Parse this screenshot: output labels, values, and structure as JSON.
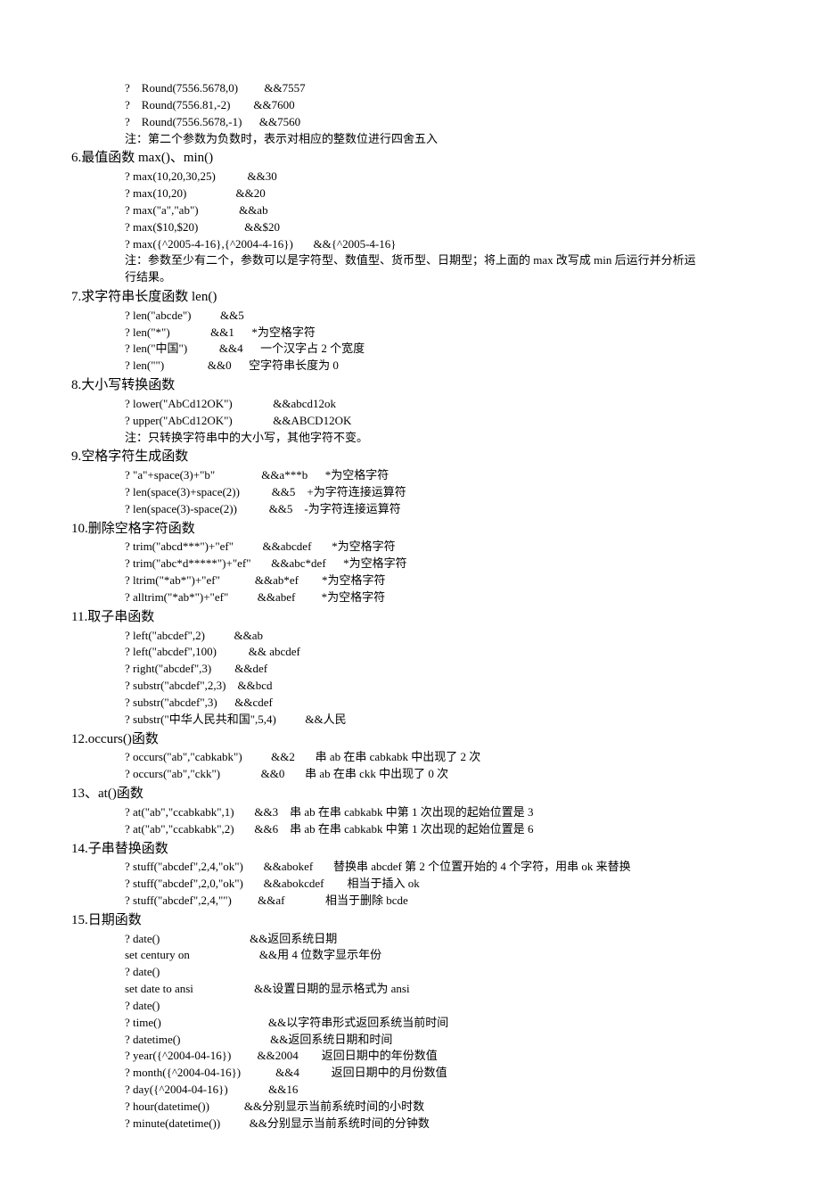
{
  "lines": [
    {
      "cls": "indent1",
      "t": "?    Round(7556.5678,0)         &&7557"
    },
    {
      "cls": "indent1",
      "t": "?    Round(7556.81,-2)        &&7600"
    },
    {
      "cls": "indent1",
      "t": "?    Round(7556.5678,-1)      &&7560"
    },
    {
      "cls": "indent1",
      "t": "注：第二个参数为负数时，表示对相应的整数位进行四舍五入"
    },
    {
      "cls": "heading",
      "t": "6.最值函数 max()、min()"
    },
    {
      "cls": "indent2",
      "t": "? max(10,20,30,25)           &&30"
    },
    {
      "cls": "indent2",
      "t": "? max(10,20)                 &&20"
    },
    {
      "cls": "indent2",
      "t": "? max(\"a\",\"ab\")              &&ab"
    },
    {
      "cls": "indent2",
      "t": "? max($10,$20)                &&$20"
    },
    {
      "cls": "indent2",
      "t": "? max({^2005-4-16},{^2004-4-16})       &&{^2005-4-16}"
    },
    {
      "cls": "indent2",
      "t": "注：参数至少有二个，参数可以是字符型、数值型、货币型、日期型；将上面的 max 改写成 min 后运行并分析运"
    },
    {
      "cls": "indent2",
      "t": "行结果。"
    },
    {
      "cls": "heading",
      "t": "7.求字符串长度函数 len()"
    },
    {
      "cls": "indent2",
      "t": "? len(\"abcde\")          &&5"
    },
    {
      "cls": "indent2",
      "t": "? len(\"*\")              &&1      *为空格字符"
    },
    {
      "cls": "indent2",
      "t": "? len(\"中国\")           &&4      一个汉字占 2 个宽度"
    },
    {
      "cls": "indent2",
      "t": "? len(\"\")               &&0      空字符串长度为 0"
    },
    {
      "cls": "heading",
      "t": "8.大小写转换函数"
    },
    {
      "cls": "indent2",
      "t": "? lower(\"AbCd12OK\")              &&abcd12ok"
    },
    {
      "cls": "indent2",
      "t": "? upper(\"AbCd12OK\")              &&ABCD12OK"
    },
    {
      "cls": "indent2",
      "t": "注：只转换字符串中的大小写，其他字符不变。"
    },
    {
      "cls": "heading",
      "t": "9.空格字符生成函数"
    },
    {
      "cls": "indent2",
      "t": "? \"a\"+space(3)+\"b\"                &&a***b      *为空格字符"
    },
    {
      "cls": "indent2",
      "t": "? len(space(3)+space(2))           &&5    +为字符连接运算符"
    },
    {
      "cls": "indent2",
      "t": "? len(space(3)-space(2))           &&5    -为字符连接运算符"
    },
    {
      "cls": "heading",
      "t": "10.删除空格字符函数"
    },
    {
      "cls": "indent2",
      "t": "? trim(\"abcd***\")+\"ef\"          &&abcdef       *为空格字符"
    },
    {
      "cls": "indent2",
      "t": "? trim(\"abc*d*****\")+\"ef\"       &&abc*def      *为空格字符"
    },
    {
      "cls": "indent2",
      "t": "? ltrim(\"*ab*\")+\"ef\"            &&ab*ef        *为空格字符"
    },
    {
      "cls": "indent2",
      "t": "? alltrim(\"*ab*\")+\"ef\"          &&abef         *为空格字符"
    },
    {
      "cls": "heading",
      "t": "11.取子串函数"
    },
    {
      "cls": "indent2",
      "t": "? left(\"abcdef\",2)          &&ab"
    },
    {
      "cls": "indent2",
      "t": "? left(\"abcdef\",100)           && abcdef"
    },
    {
      "cls": "indent2",
      "t": "? right(\"abcdef\",3)        &&def"
    },
    {
      "cls": "indent2",
      "t": "? substr(\"abcdef\",2,3)    &&bcd"
    },
    {
      "cls": "indent2",
      "t": "? substr(\"abcdef\",3)      &&cdef"
    },
    {
      "cls": "indent2",
      "t": "? substr(\"中华人民共和国\",5,4)          &&人民"
    },
    {
      "cls": "heading",
      "t": "12.occurs()函数"
    },
    {
      "cls": "indent2",
      "t": "? occurs(\"ab\",\"cabkabk\")          &&2       串 ab 在串 cabkabk 中出现了 2 次"
    },
    {
      "cls": "indent2",
      "t": "? occurs(\"ab\",\"ckk\")              &&0       串 ab 在串 ckk 中出现了 0 次"
    },
    {
      "cls": "heading",
      "t": "13、at()函数"
    },
    {
      "cls": "indent2",
      "t": "? at(\"ab\",\"ccabkabk\",1)       &&3    串 ab 在串 cabkabk 中第 1 次出现的起始位置是 3"
    },
    {
      "cls": "indent2",
      "t": "? at(\"ab\",\"ccabkabk\",2)       &&6    串 ab 在串 cabkabk 中第 1 次出现的起始位置是 6"
    },
    {
      "cls": "heading",
      "t": "14.子串替换函数"
    },
    {
      "cls": "indent2",
      "t": "? stuff(\"abcdef\",2,4,\"ok\")       &&abokef       替换串 abcdef 第 2 个位置开始的 4 个字符，用串 ok 来替换"
    },
    {
      "cls": "indent2",
      "t": "? stuff(\"abcdef\",2,0,\"ok\")       &&abokcdef        相当于插入 ok"
    },
    {
      "cls": "indent2",
      "t": "? stuff(\"abcdef\",2,4,\"\")         &&af              相当于删除 bcde"
    },
    {
      "cls": "heading",
      "t": "15.日期函数"
    },
    {
      "cls": "indent2",
      "t": "? date()                               &&返回系统日期"
    },
    {
      "cls": "indent2",
      "t": "set century on                        &&用 4 位数字显示年份"
    },
    {
      "cls": "indent2",
      "t": "? date()"
    },
    {
      "cls": "indent2",
      "t": "set date to ansi                     &&设置日期的显示格式为 ansi"
    },
    {
      "cls": "indent2",
      "t": "? date()"
    },
    {
      "cls": "indent2",
      "t": "? time()                                     &&以字符串形式返回系统当前时间"
    },
    {
      "cls": "indent2",
      "t": "? datetime()                               &&返回系统日期和时间"
    },
    {
      "cls": "indent2",
      "t": "? year({^2004-04-16})         &&2004        返回日期中的年份数值"
    },
    {
      "cls": "indent2",
      "t": "? month({^2004-04-16})            &&4           返回日期中的月份数值"
    },
    {
      "cls": "indent2",
      "t": "? day({^2004-04-16})              &&16"
    },
    {
      "cls": "indent2",
      "t": "? hour(datetime())            &&分别显示当前系统时间的小时数"
    },
    {
      "cls": "indent2",
      "t": "? minute(datetime())          &&分别显示当前系统时间的分钟数"
    }
  ]
}
